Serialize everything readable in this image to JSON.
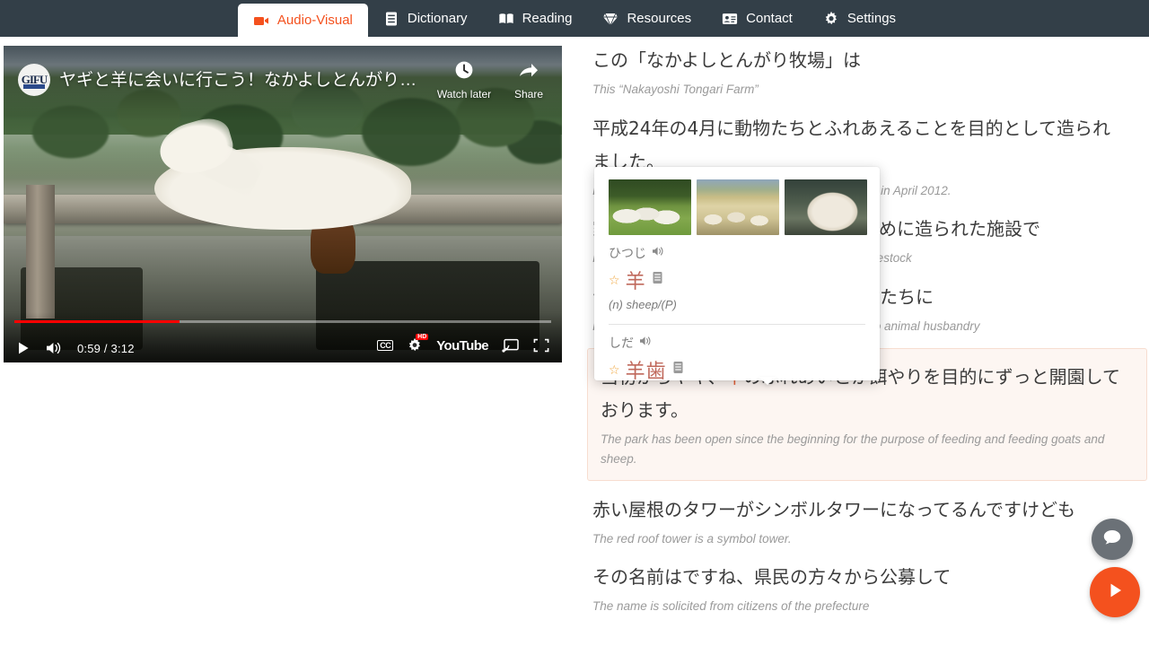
{
  "nav": {
    "items": [
      {
        "label": "Audio-Visual",
        "icon": "video-camera-icon",
        "active": true
      },
      {
        "label": "Dictionary",
        "icon": "book-closed-icon",
        "active": false
      },
      {
        "label": "Reading",
        "icon": "book-open-icon",
        "active": false
      },
      {
        "label": "Resources",
        "icon": "gem-icon",
        "active": false
      },
      {
        "label": "Contact",
        "icon": "id-card-icon",
        "active": false
      },
      {
        "label": "Settings",
        "icon": "gear-icon",
        "active": false
      }
    ]
  },
  "video": {
    "title": "ヤギと羊に会いに行こう！なかよしとんがり牧場…",
    "channel_avatar_text": "GIFU",
    "watch_later_label": "Watch later",
    "share_label": "Share",
    "current_time": "0:59",
    "duration": "3:12",
    "time_display": "0:59 / 3:12",
    "progress_percent": 30.7,
    "cc_label": "CC",
    "hd_label": "HD",
    "wordmark": "YouTube"
  },
  "transcript": {
    "lines": [
      {
        "jp": "この「なかよしとんがり牧場」は",
        "en": "This “Nakayoshi Tongari Farm”",
        "highlight": false
      },
      {
        "jp": "平成24年の4月に動物たちとふれあえることを目的として造られました。",
        "en": "It was built for the purpose of interacting with animals in April 2012.",
        "highlight": false
      },
      {
        "jp": "家畜に対する理解を深めてもらうために造られた施設で",
        "en": "It is a facility built to deepen your understanding of livestock",
        "highlight": false
      },
      {
        "jp": "ヤギや羊のほか畜産に関係ある動物たちに",
        "en": "In addition to goats and sheep, and animals related to animal husbandry",
        "highlight": false
      },
      {
        "jp_pre": "当初からヤギ、",
        "jp_ruby_base": "羊",
        "jp_ruby_text": "ひつじ",
        "jp_post": "のふれあいとか餌やりを目的にずっと開園しております。",
        "en": "The park has been open since the beginning for the purpose of feeding and feeding goats and sheep.",
        "highlight": true
      },
      {
        "jp": "赤い屋根のタワーがシンボルタワーになってるんですけども",
        "en": "The red roof tower is a symbol tower.",
        "highlight": false
      },
      {
        "jp": "その名前はですね、県民の方々から公募して",
        "en": "The name is solicited from citizens of the prefecture",
        "highlight": false
      }
    ]
  },
  "dictionary_popup": {
    "images": [
      {
        "alt": "sheep-flock-grass-photo"
      },
      {
        "alt": "sheep-herd-field-photo"
      },
      {
        "alt": "sheep-closeup-photo"
      }
    ],
    "entries": [
      {
        "reading": "ひつじ",
        "kanji": "羊",
        "gloss": "(n) sheep/(P)",
        "speaker_icon": "speaker-icon",
        "star_icon": "star-outline-icon",
        "book_icon": "book-icon"
      },
      {
        "reading": "しだ",
        "kanji": "羊歯",
        "gloss": "",
        "speaker_icon": "speaker-icon",
        "star_icon": "star-outline-icon",
        "book_icon": "book-icon"
      }
    ]
  },
  "fabs": [
    {
      "name": "chat-button",
      "icon": "chat-bubble-icon",
      "color": "#6b7177"
    },
    {
      "name": "play-button",
      "icon": "play-triangle-icon",
      "color": "#f4511e"
    }
  ],
  "colors": {
    "header_bg": "#333f48",
    "accent_orange": "#f4511e",
    "kanji_red": "#c0695c",
    "highlight_bg": "#fdf6f2",
    "highlight_border": "#f7ddd0",
    "english_gray": "#9a9a9a"
  }
}
